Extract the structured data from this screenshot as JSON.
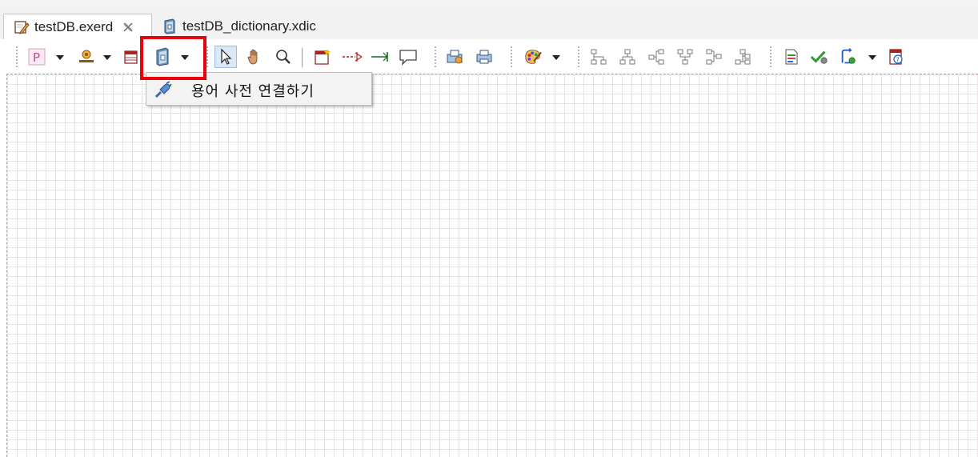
{
  "tabs": [
    {
      "label": "testDB.exerd",
      "active": true,
      "icon": "erd-edit-icon",
      "closable": true
    },
    {
      "label": "testDB_dictionary.xdic",
      "active": false,
      "icon": "dictionary-icon",
      "closable": false
    }
  ],
  "toolbar": {
    "icons": [
      "page-p-icon",
      "stamp-icon",
      "table-icon",
      "dictionary-icon",
      "select-arrow-icon",
      "hand-icon",
      "zoom-icon",
      "new-table-icon",
      "relation-dashed-icon",
      "relation-solid-icon",
      "comment-icon",
      "import-icon",
      "print-icon",
      "palette-icon",
      "layout-1-icon",
      "layout-2-icon",
      "layout-3-icon",
      "layout-4-icon",
      "layout-5-icon",
      "layout-6-icon",
      "document-icon",
      "validate-check-icon",
      "sync-icon",
      "help-doc-icon"
    ]
  },
  "dropdown_menu": {
    "items": [
      {
        "label": "용어 사전 연결하기",
        "icon": "plug-icon"
      }
    ]
  },
  "colors": {
    "highlight": "#e8000b",
    "grid": "#f6dcdc",
    "menu_bg": "#f3f3f3"
  }
}
